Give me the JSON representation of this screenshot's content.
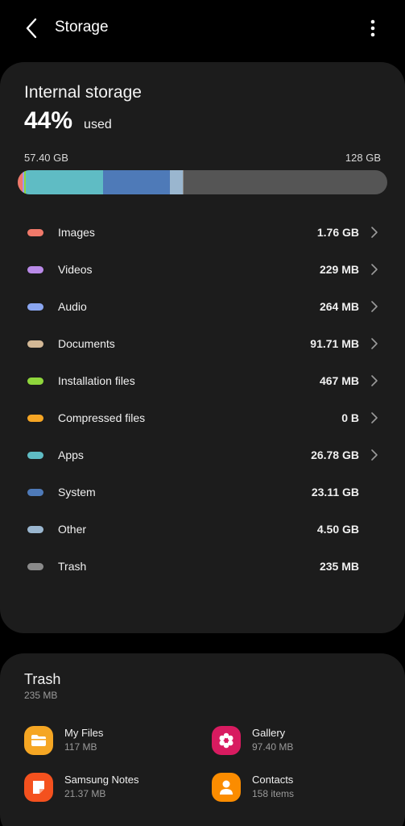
{
  "header": {
    "title": "Storage",
    "back_icon": "chevron-left-icon",
    "more_icon": "more-vertical-icon"
  },
  "internal": {
    "title": "Internal storage",
    "percent": "44%",
    "used_label": "used",
    "used_amount": "57.40 GB",
    "total_amount": "128 GB",
    "bar_segments": [
      {
        "name": "Images",
        "fraction": 0.0138,
        "color": "#f0796a"
      },
      {
        "name": "Videos",
        "fraction": 0.0018,
        "color": "#b98ae8"
      },
      {
        "name": "Audio",
        "fraction": 0.0021,
        "color": "#8aa6f0"
      },
      {
        "name": "Documents",
        "fraction": 0.0007,
        "color": "#d3b896"
      },
      {
        "name": "Installation files",
        "fraction": 0.0036,
        "color": "#8fd63c"
      },
      {
        "name": "Apps",
        "fraction": 0.2092,
        "color": "#5fbcc4"
      },
      {
        "name": "System",
        "fraction": 0.1805,
        "color": "#4e7ab8"
      },
      {
        "name": "Other",
        "fraction": 0.0352,
        "color": "#9ab6cf"
      },
      {
        "name": "Trash",
        "fraction": 0.0018,
        "color": "#8a8a8a"
      }
    ]
  },
  "categories": [
    {
      "label": "Images",
      "size": "1.76 GB",
      "color": "#f0796a",
      "chevron": true
    },
    {
      "label": "Videos",
      "size": "229 MB",
      "color": "#b98ae8",
      "chevron": true
    },
    {
      "label": "Audio",
      "size": "264 MB",
      "color": "#8aa6f0",
      "chevron": true
    },
    {
      "label": "Documents",
      "size": "91.71 MB",
      "color": "#d3b896",
      "chevron": true
    },
    {
      "label": "Installation files",
      "size": "467 MB",
      "color": "#8fd63c",
      "chevron": true
    },
    {
      "label": "Compressed files",
      "size": "0 B",
      "color": "#f5a524",
      "chevron": true
    },
    {
      "label": "Apps",
      "size": "26.78 GB",
      "color": "#5fbcc4",
      "chevron": true
    },
    {
      "label": "System",
      "size": "23.11 GB",
      "color": "#4e7ab8",
      "chevron": false
    },
    {
      "label": "Other",
      "size": "4.50 GB",
      "color": "#9ab6cf",
      "chevron": false
    },
    {
      "label": "Trash",
      "size": "235 MB",
      "color": "#8a8a8a",
      "chevron": false
    }
  ],
  "trash": {
    "title": "Trash",
    "size": "235 MB",
    "items": [
      {
        "name": "My Files",
        "sub": "117 MB",
        "icon": "folder-icon",
        "color": "#f5a623"
      },
      {
        "name": "Gallery",
        "sub": "97.40 MB",
        "icon": "flower-icon",
        "color": "#d81b60"
      },
      {
        "name": "Samsung Notes",
        "sub": "21.37 MB",
        "icon": "notes-icon",
        "color": "#f4511e"
      },
      {
        "name": "Contacts",
        "sub": "158 items",
        "icon": "contact-icon",
        "color": "#fb8c00"
      }
    ]
  }
}
